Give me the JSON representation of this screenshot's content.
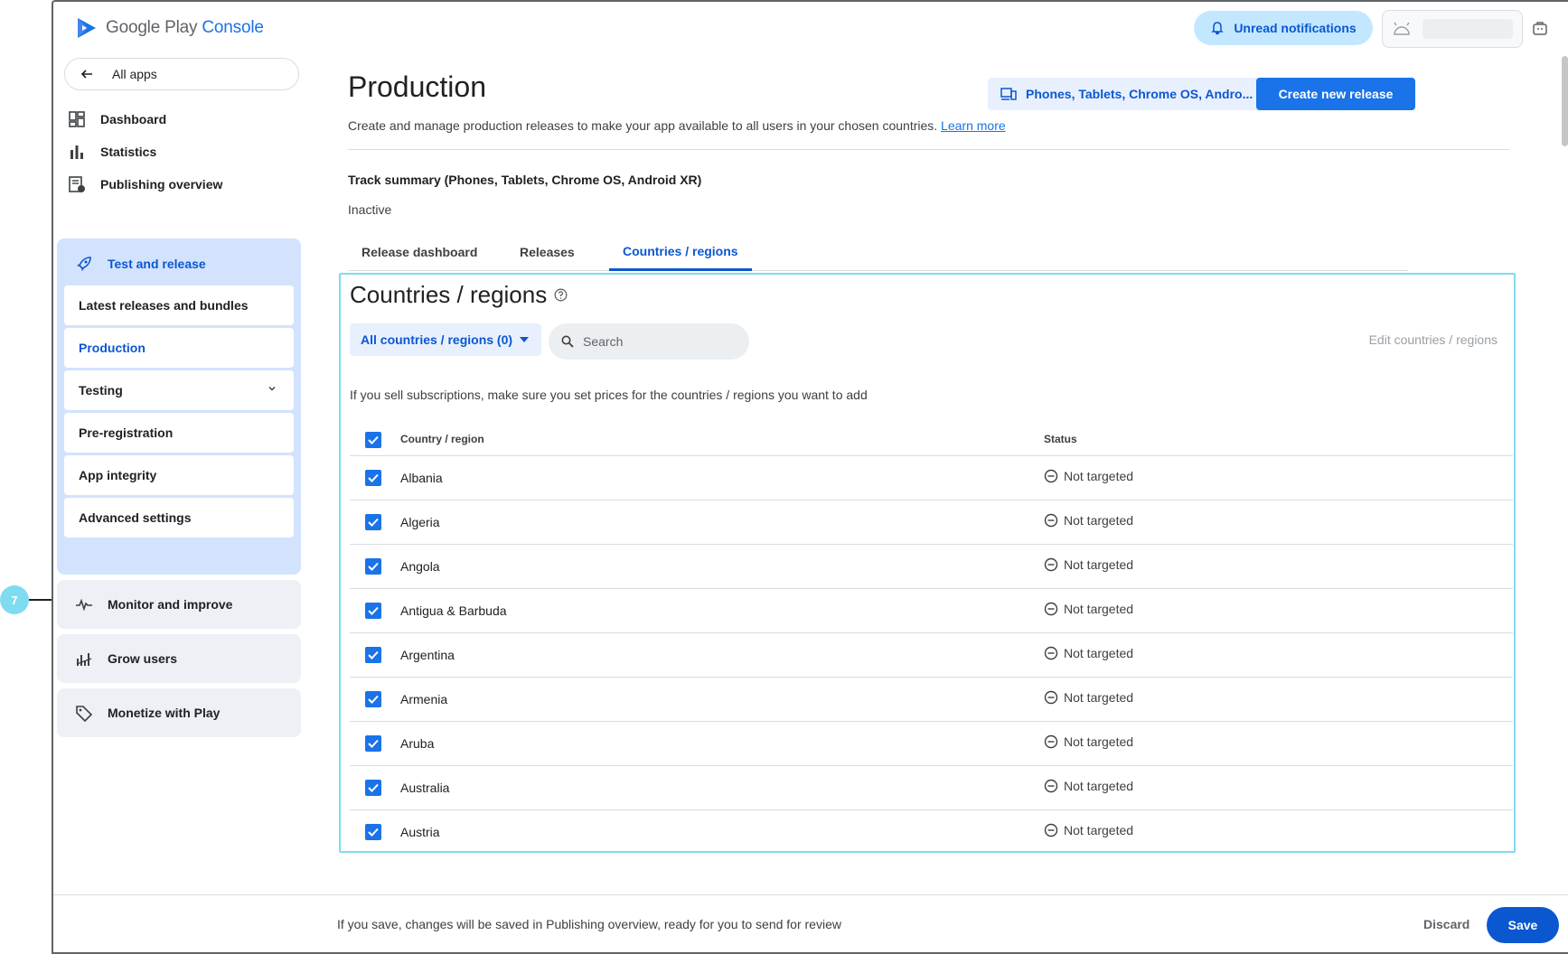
{
  "header": {
    "logo_google_play": "Google Play",
    "logo_console": "Console",
    "notifications_label": "Unread notifications"
  },
  "sidebar": {
    "all_apps": "All apps",
    "top_items": [
      {
        "label": "Dashboard",
        "icon": "dashboard-icon"
      },
      {
        "label": "Statistics",
        "icon": "bar-chart-icon"
      },
      {
        "label": "Publishing overview",
        "icon": "publishing-icon"
      }
    ],
    "section": {
      "title": "Test and release",
      "items": [
        {
          "label": "Latest releases and bundles"
        },
        {
          "label": "Production"
        },
        {
          "label": "Testing"
        },
        {
          "label": "Pre-registration"
        },
        {
          "label": "App integrity"
        },
        {
          "label": "Advanced settings"
        }
      ]
    },
    "groups": [
      {
        "label": "Monitor and improve",
        "icon": "pulse-icon"
      },
      {
        "label": "Grow users",
        "icon": "grow-icon"
      },
      {
        "label": "Monetize with Play",
        "icon": "tag-icon"
      }
    ]
  },
  "main": {
    "title": "Production",
    "description": "Create and manage production releases to make your app available to all users in your chosen countries.",
    "learn_more": "Learn more",
    "device_selector": "Phones, Tablets, Chrome OS, Andro...",
    "create_release": "Create new release",
    "track_summary": "Track summary (Phones, Tablets, Chrome OS, Android XR)",
    "track_status": "Inactive",
    "tabs": [
      {
        "label": "Release dashboard"
      },
      {
        "label": "Releases"
      },
      {
        "label": "Countries / regions"
      }
    ]
  },
  "countries": {
    "title": "Countries / regions",
    "filter_label": "All countries / regions (0)",
    "search_placeholder": "Search",
    "edit_link": "Edit countries / regions",
    "info": "If you sell subscriptions, make sure you set prices for the countries / regions you want to add",
    "col_country": "Country / region",
    "col_status": "Status",
    "rows": [
      {
        "name": "Albania",
        "status": "Not targeted"
      },
      {
        "name": "Algeria",
        "status": "Not targeted"
      },
      {
        "name": "Angola",
        "status": "Not targeted"
      },
      {
        "name": "Antigua & Barbuda",
        "status": "Not targeted"
      },
      {
        "name": "Argentina",
        "status": "Not targeted"
      },
      {
        "name": "Armenia",
        "status": "Not targeted"
      },
      {
        "name": "Aruba",
        "status": "Not targeted"
      },
      {
        "name": "Australia",
        "status": "Not targeted"
      },
      {
        "name": "Austria",
        "status": "Not targeted"
      }
    ]
  },
  "footer": {
    "message": "If you save, changes will be saved in Publishing overview, ready for you to send for review",
    "discard": "Discard",
    "save": "Save"
  },
  "annotation": {
    "number": "7"
  },
  "colors": {
    "accent": "#1a73e8",
    "accent_dark": "#0b57d0",
    "section_bg": "#d3e3fd",
    "highlight_border": "#7fdcf0"
  }
}
